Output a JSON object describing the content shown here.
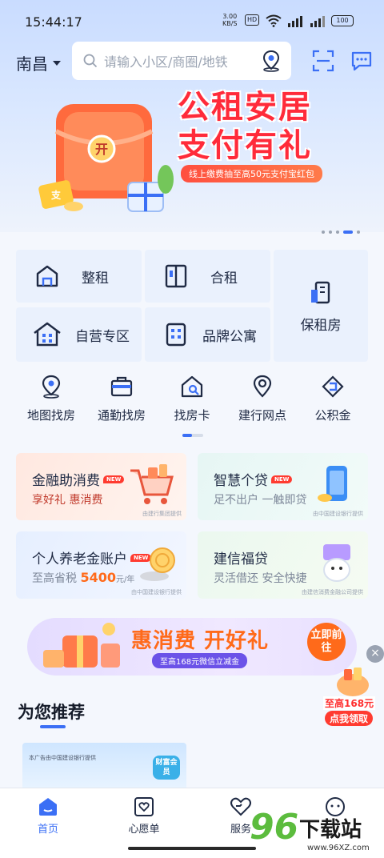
{
  "status_bar": {
    "time": "15:44:17",
    "net_rate_value": "3.00",
    "net_rate_unit": "KB/S",
    "hd": "HD",
    "battery": "100"
  },
  "header": {
    "city": "南昌",
    "search_placeholder": "请输入小区/商圈/地铁"
  },
  "banner": {
    "title_line1": "公租安居",
    "title_line2": "支付有礼",
    "subtitle": "线上缴费抽至高50元支付宝红包",
    "coin_char": "开",
    "card_char": "支"
  },
  "categories": {
    "zhengzu": "整租",
    "hezu": "合租",
    "baozufang": "保租房",
    "ziying": "自营专区",
    "pinpai": "品牌公寓"
  },
  "quick_nav": [
    {
      "label": "地图找房",
      "icon": "map-pin-icon"
    },
    {
      "label": "通勤找房",
      "icon": "briefcase-icon"
    },
    {
      "label": "找房卡",
      "icon": "house-search-icon"
    },
    {
      "label": "建行网点",
      "icon": "location-icon"
    },
    {
      "label": "公积金",
      "icon": "fund-icon"
    }
  ],
  "finance": {
    "jrzxf": {
      "title": "金融助消费",
      "badge": "NEW",
      "sub": "享好礼 惠消费",
      "note": "由建行集团提供"
    },
    "zhgd": {
      "title": "智慧个贷",
      "badge": "NEW",
      "sub": "足不出户 一触即贷",
      "note": "由中国建设银行提供"
    },
    "yljzh": {
      "title": "个人养老金账户",
      "badge": "NEW",
      "sub_prefix": "至高省税",
      "sub_amount": "5400",
      "sub_unit": "元/年",
      "note": "由中国建设银行提供"
    },
    "jxfd": {
      "title": "建信福贷",
      "sub": "灵活借还 安全快捷",
      "note": "由建信消费金融公司提供"
    }
  },
  "promo": {
    "title": "惠消费 开好礼",
    "sub": "至高168元微信立减金",
    "go": "立即前往"
  },
  "floating": {
    "line1": "至高168元",
    "line2": "点我领取"
  },
  "recommend": {
    "title": "为您推荐",
    "ad_text": "本广告由中国建设银行提供",
    "ad_badge": "财富会员"
  },
  "tabs": {
    "home": "首页",
    "wishlist": "心愿单",
    "service": "服务"
  },
  "watermark": {
    "big": "96",
    "cn": "下载站",
    "url": "www.96XZ.com"
  },
  "colors": {
    "accent": "#3b6ff5",
    "red": "#ff2b3a",
    "orange": "#ff6a1a"
  }
}
